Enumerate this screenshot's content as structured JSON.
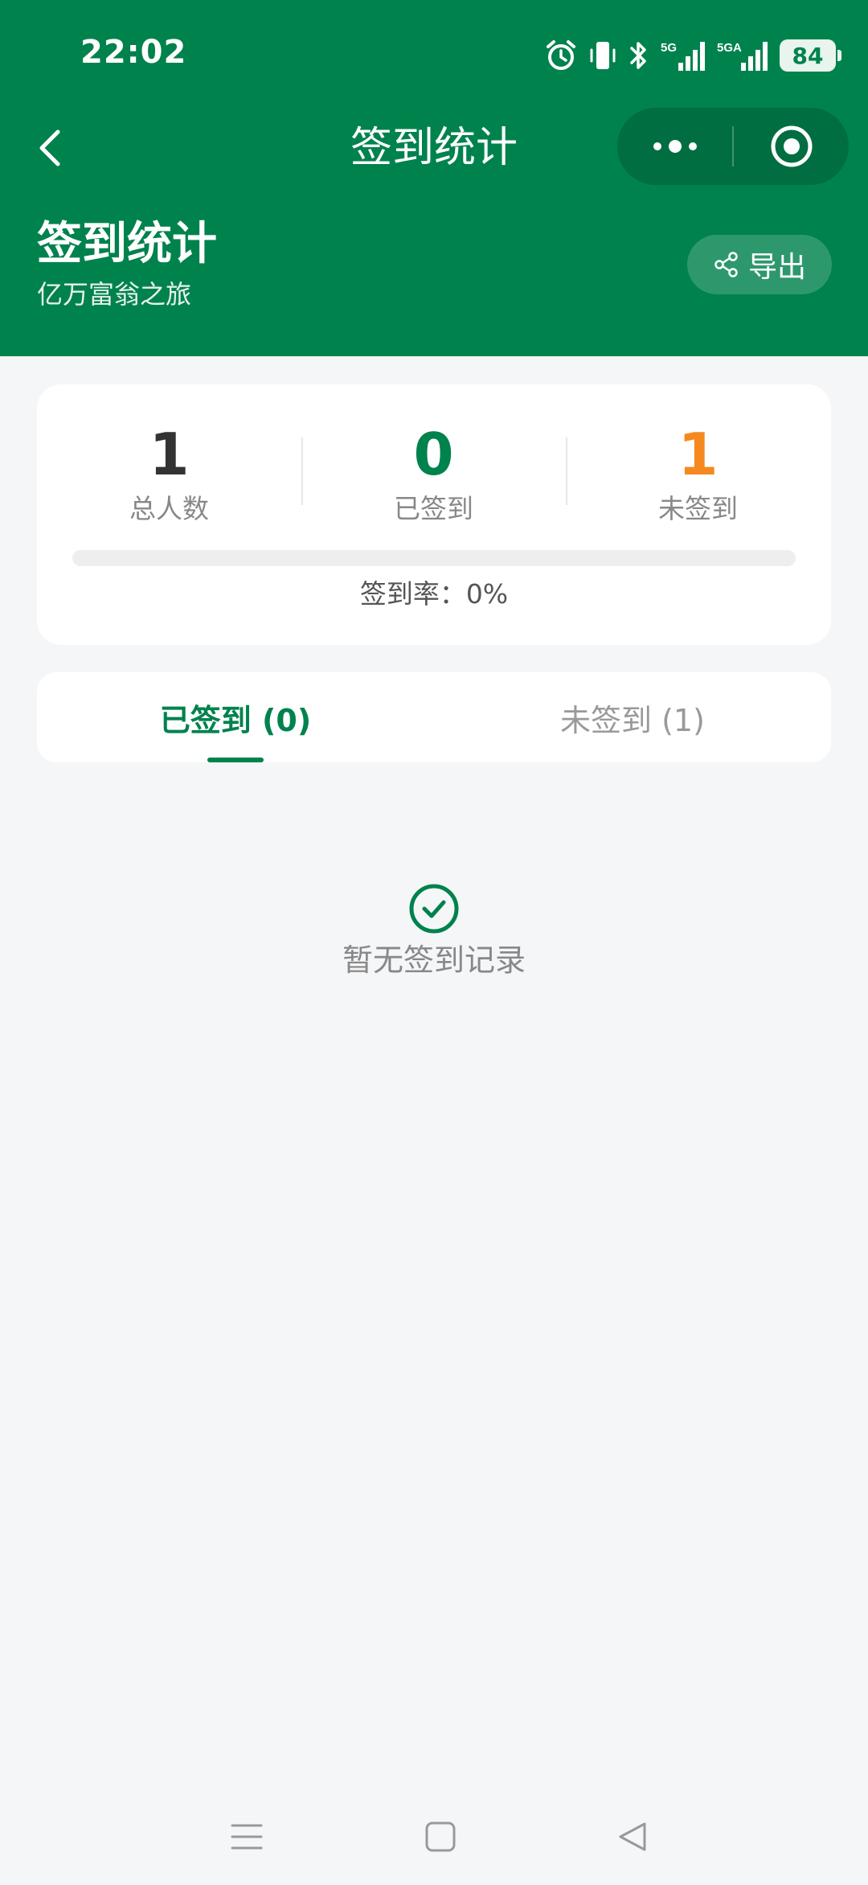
{
  "status_bar": {
    "time": "22:02",
    "network_1": "5G",
    "network_2": "5GA",
    "battery": "84"
  },
  "nav": {
    "title": "签到统计"
  },
  "header": {
    "heading": "签到统计",
    "subheading": "亿万富翁之旅",
    "export_label": "导出"
  },
  "stats": {
    "total": {
      "value": "1",
      "label": "总人数",
      "color": "#333333"
    },
    "signed": {
      "value": "0",
      "label": "已签到",
      "color": "#00824d"
    },
    "unsigned": {
      "value": "1",
      "label": "未签到",
      "color": "#f5891f"
    },
    "rate_text": "签到率：0%",
    "rate_fraction": 0
  },
  "tabs": [
    {
      "label": "已签到 (0)",
      "active": true
    },
    {
      "label": "未签到 (1)",
      "active": false
    }
  ],
  "empty_state": {
    "icon": "check-circle-icon",
    "text": "暂无签到记录"
  },
  "colors": {
    "brand": "#00824d",
    "warning": "#f5891f",
    "background": "#f5f6f8"
  },
  "system_nav": {
    "icons": [
      "menu-icon",
      "home-icon",
      "back-triangle-icon"
    ]
  }
}
